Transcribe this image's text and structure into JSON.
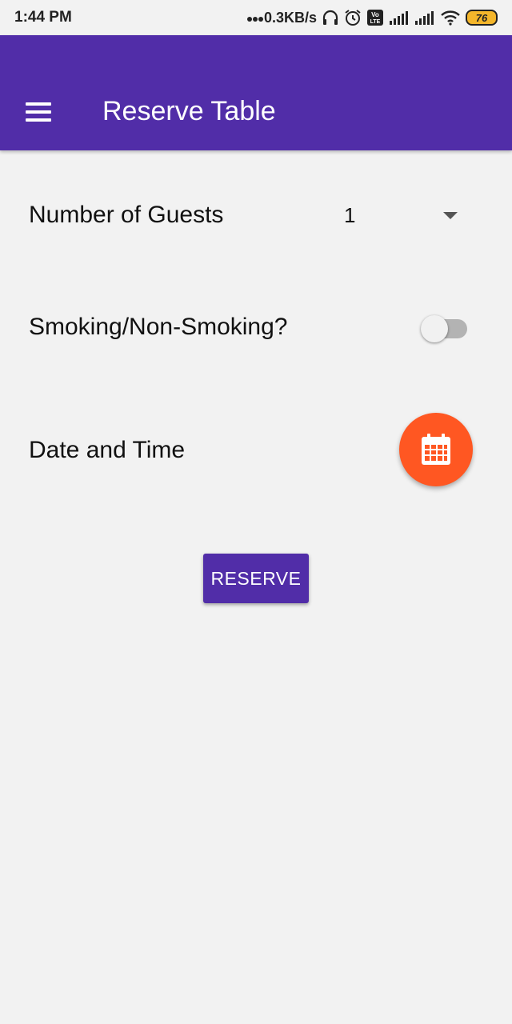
{
  "status_bar": {
    "time": "1:44 PM",
    "network_speed": "0.3KB/s",
    "battery_level": "76",
    "icons": [
      "dots-icon",
      "headset-icon",
      "alarm-icon",
      "volte-icon",
      "signal-icon",
      "signal-icon",
      "wifi-icon",
      "battery-icon"
    ]
  },
  "app_bar": {
    "title": "Reserve Table",
    "menu_icon": "hamburger-menu-icon",
    "color": "#512da8"
  },
  "form": {
    "guests": {
      "label": "Number of Guests",
      "value": "1"
    },
    "smoking": {
      "label": "Smoking/Non-Smoking?",
      "checked": false
    },
    "datetime": {
      "label": "Date and Time",
      "icon": "calendar-icon",
      "fab_color": "#ff5722"
    }
  },
  "actions": {
    "reserve_label": "RESERVE"
  }
}
